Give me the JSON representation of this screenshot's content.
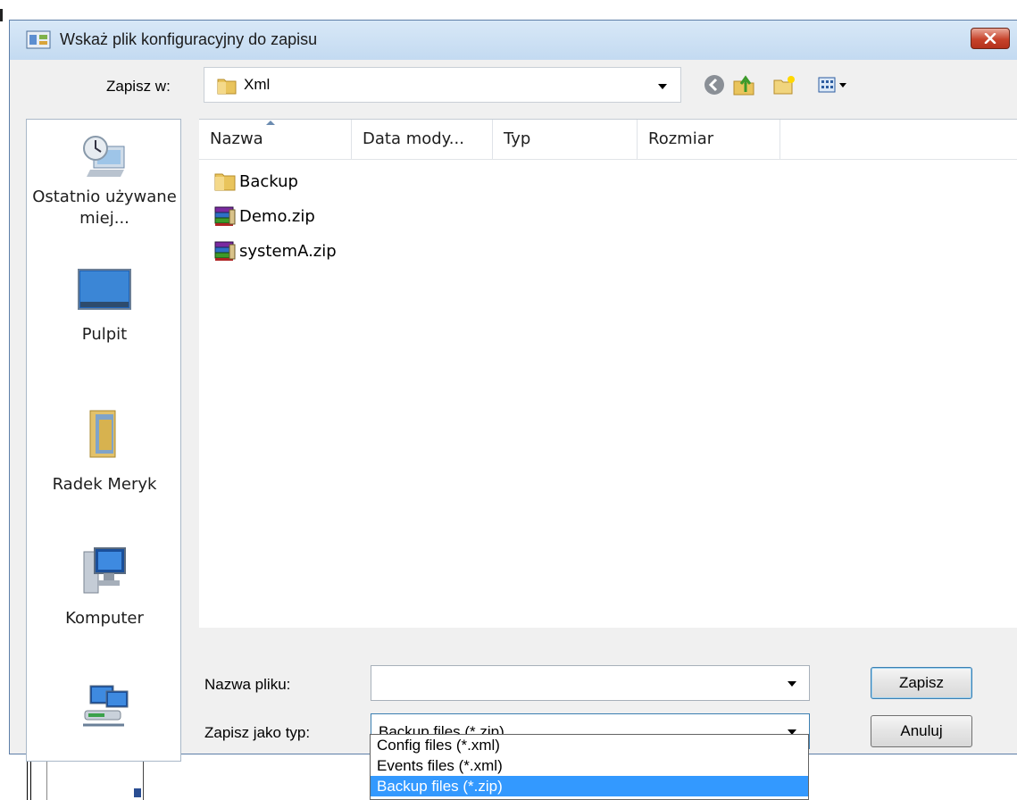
{
  "dialog": {
    "title": "Wskaż plik konfiguracyjny do zapisu",
    "close_icon": "close-icon"
  },
  "toolbar": {
    "save_in_label": "Zapisz w:",
    "save_in_value": "Xml",
    "icons": [
      "back-icon",
      "up-folder-icon",
      "new-folder-icon",
      "view-menu-icon"
    ]
  },
  "places": [
    {
      "label": "Ostatnio używane miej...",
      "icon": "recent-places-icon"
    },
    {
      "label": "Pulpit",
      "icon": "desktop-icon"
    },
    {
      "label": "Radek Meryk",
      "icon": "user-folder-icon"
    },
    {
      "label": "Komputer",
      "icon": "computer-icon"
    },
    {
      "label": "",
      "icon": "network-icon"
    }
  ],
  "columns": [
    "Nazwa",
    "Data mody...",
    "Typ",
    "Rozmiar"
  ],
  "files": [
    {
      "name": "Backup",
      "icon": "folder-icon"
    },
    {
      "name": "Demo.zip",
      "icon": "zip-archive-icon"
    },
    {
      "name": "systemA.zip",
      "icon": "zip-archive-icon"
    }
  ],
  "filename": {
    "label": "Nazwa pliku:",
    "value": ""
  },
  "filetype": {
    "label": "Zapisz jako typ:",
    "value": "Backup files (*.zip)",
    "options": [
      "Config files (*.xml)",
      "Events files (*.xml)",
      "Backup files (*.zip)"
    ],
    "selected_index": 2
  },
  "buttons": {
    "save": "Zapisz",
    "cancel": "Anuluj"
  },
  "colors": {
    "titlebar": "#cfe2f4",
    "selection": "#3399ff",
    "close_button": "#c7432b"
  }
}
